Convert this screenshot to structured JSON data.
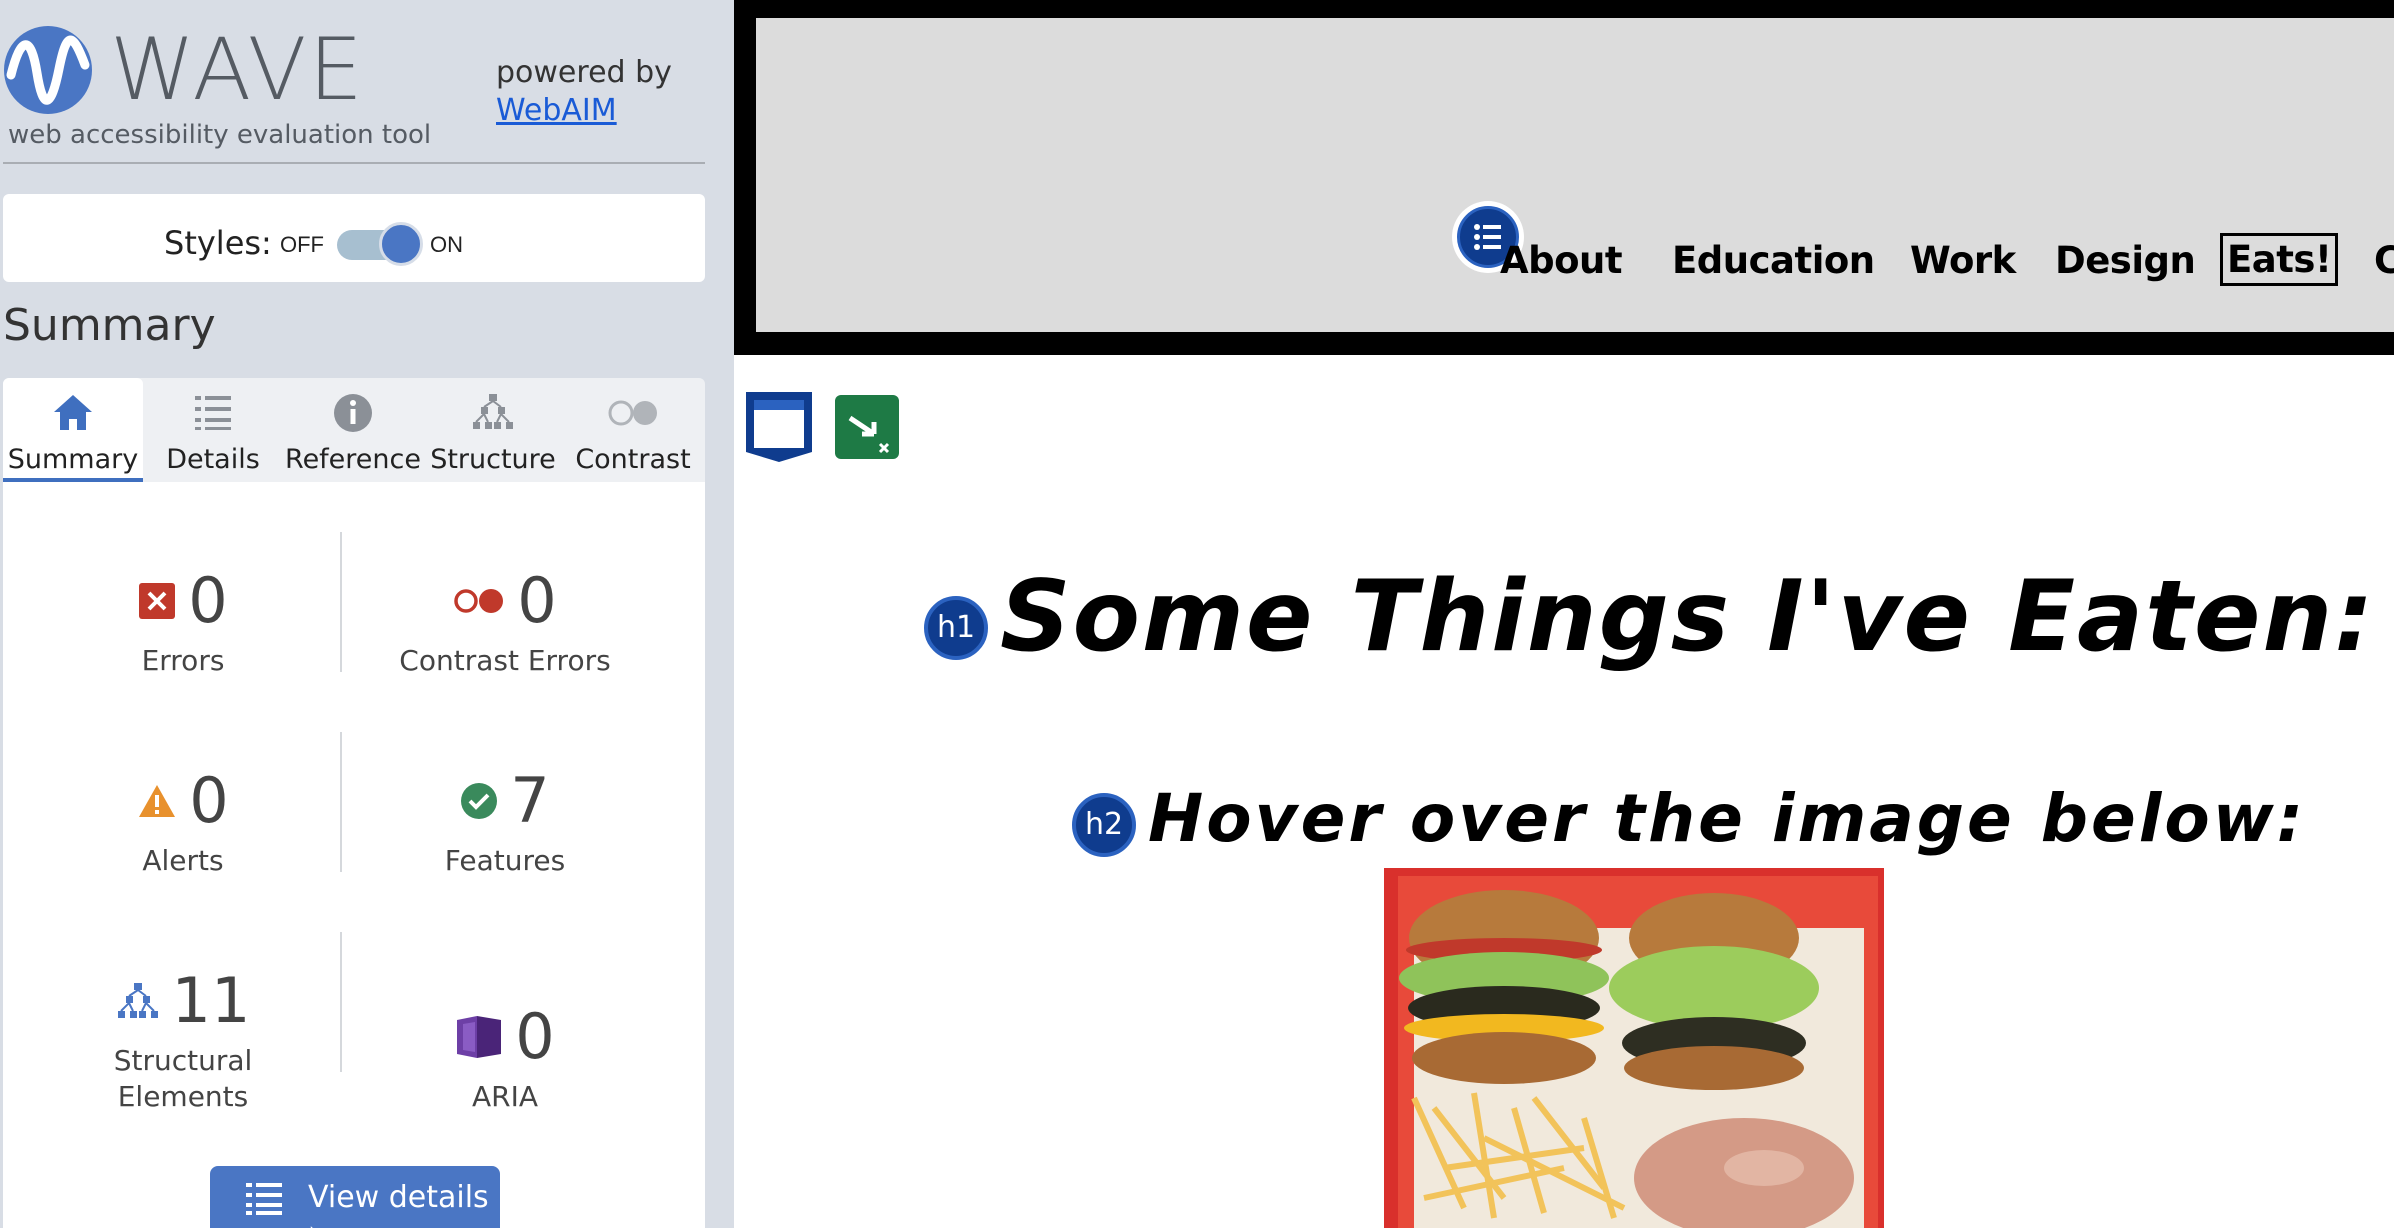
{
  "wave": {
    "title": "WAVE",
    "subtitle": "web accessibility evaluation tool",
    "powered_by": "powered by",
    "webaim_link": "WebAIM"
  },
  "styles_toggle": {
    "label": "Styles:",
    "off": "OFF",
    "on": "ON",
    "state": "on"
  },
  "summary_heading": "Summary",
  "tabs": [
    {
      "label": "Summary",
      "icon": "home-icon",
      "active": true
    },
    {
      "label": "Details",
      "icon": "list-icon",
      "active": false
    },
    {
      "label": "Reference",
      "icon": "info-icon",
      "active": false
    },
    {
      "label": "Structure",
      "icon": "structure-icon",
      "active": false
    },
    {
      "label": "Contrast",
      "icon": "contrast-icon",
      "active": false
    }
  ],
  "stats": {
    "errors": {
      "count": "0",
      "label": "Errors"
    },
    "contrast_errors": {
      "count": "0",
      "label": "Contrast Errors"
    },
    "alerts": {
      "count": "0",
      "label": "Alerts"
    },
    "features": {
      "count": "7",
      "label": "Features"
    },
    "structural": {
      "count": "11",
      "label_line1": "Structural",
      "label_line2": "Elements"
    },
    "aria": {
      "count": "0",
      "label": "ARIA"
    }
  },
  "view_details": "View details ›",
  "site": {
    "nav": [
      "About",
      "Education",
      "Work",
      "Design",
      "Eats!",
      "Cor"
    ],
    "current_nav": "Eats!",
    "h1_badge": "h1",
    "h2_badge": "h2",
    "h1": "Some Things I've Eaten:",
    "h2": "Hover over the image below:"
  },
  "colors": {
    "accent": "#4a76c4",
    "error": "#c0392b",
    "alert": "#e8912d",
    "feature": "#3a8a5c",
    "aria": "#5a2e8c",
    "sidebar_bg": "#d8dde5"
  }
}
